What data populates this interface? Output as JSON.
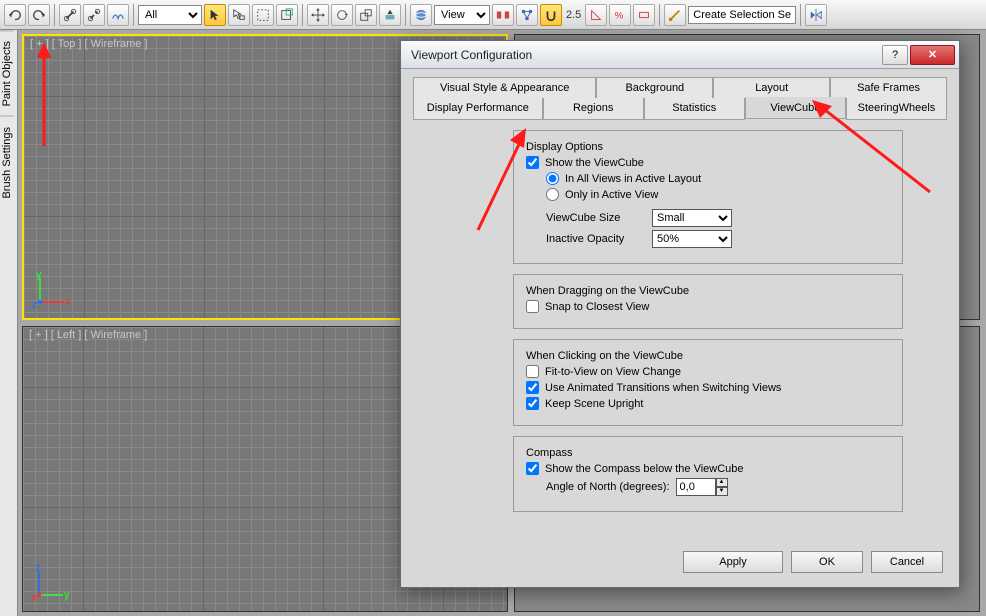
{
  "toolbar": {
    "filter": "All",
    "view_combo": "View",
    "scale_value": "2.5",
    "selection_set": "Create Selection Se"
  },
  "side_tabs": [
    "Paint Objects",
    "Brush Settings"
  ],
  "viewports": {
    "top": "[ + ] [ Top ]  [ Wireframe ]",
    "left": "[ + ] [ Left ]  [ Wireframe ]"
  },
  "dialog": {
    "title": "Viewport Configuration",
    "tabs1": [
      "Visual Style & Appearance",
      "Background",
      "Layout",
      "Safe Frames"
    ],
    "tabs2": [
      "Display Performance",
      "Regions",
      "Statistics",
      "ViewCube",
      "SteeringWheels"
    ],
    "groups": {
      "display": {
        "legend": "Display Options",
        "show": "Show the ViewCube",
        "r1": "In All Views in Active Layout",
        "r2": "Only in Active View",
        "size_lbl": "ViewCube Size",
        "size_val": "Small",
        "opac_lbl": "Inactive Opacity",
        "opac_val": "50%"
      },
      "drag": {
        "legend": "When Dragging on the ViewCube",
        "c1": "Snap to Closest View"
      },
      "click": {
        "legend": "When Clicking on the ViewCube",
        "c1": "Fit-to-View on View Change",
        "c2": "Use Animated Transitions when Switching Views",
        "c3": "Keep Scene Upright"
      },
      "compass": {
        "legend": "Compass",
        "c1": "Show the Compass below the ViewCube",
        "ang_lbl": "Angle of North (degrees):",
        "ang_val": "0,0"
      }
    },
    "buttons": {
      "apply": "Apply",
      "ok": "OK",
      "cancel": "Cancel"
    }
  }
}
